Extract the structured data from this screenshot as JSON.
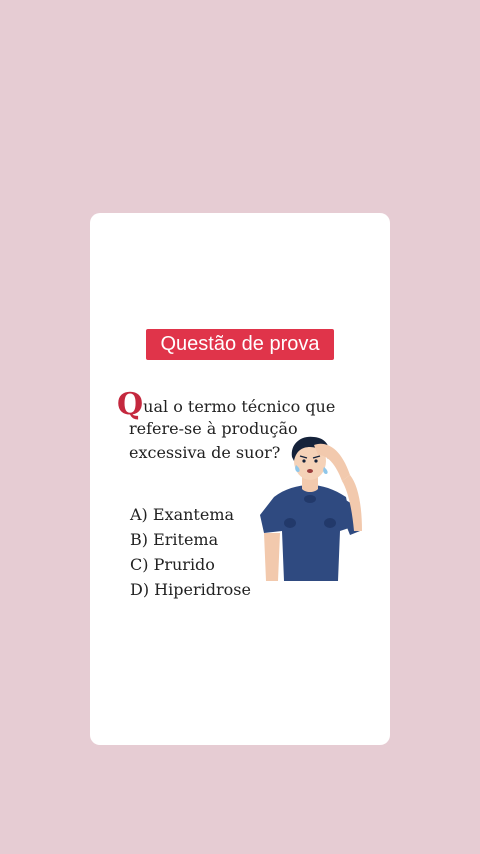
{
  "badge": {
    "label": "Questão de prova"
  },
  "question": {
    "drop_cap": "Q",
    "line1_rest": "ual o termo técnico que",
    "line2": "refere-se à produção",
    "line3": "excessiva de suor?"
  },
  "options": [
    {
      "label": "A) Exantema"
    },
    {
      "label": "B) Eritema"
    },
    {
      "label": "C) Prurido"
    },
    {
      "label": "D) Hiperidrose"
    }
  ],
  "colors": {
    "background": "#e6ccd3",
    "card": "#ffffff",
    "badge": "#e0344a",
    "drop_cap": "#c4283e",
    "shirt": "#2f4a80"
  },
  "illustration": {
    "icon": "sweating-man-illustration"
  }
}
